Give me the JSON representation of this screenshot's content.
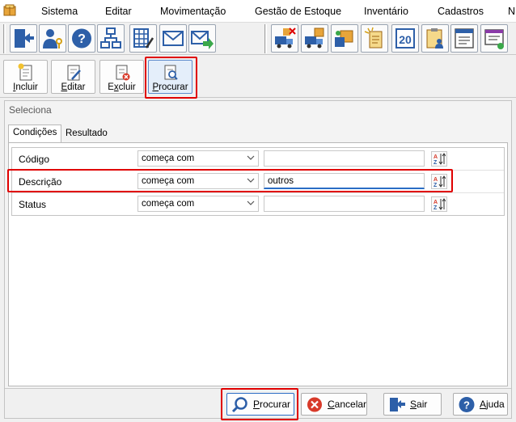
{
  "menu": {
    "items": [
      "Sistema",
      "Editar",
      "Movimentação",
      "Gestão de Estoque",
      "Inventário",
      "Cadastros",
      "N"
    ]
  },
  "toolbar": {
    "left_icons": [
      "exit-door-icon",
      "user-key-icon",
      "help-icon",
      "org-chart-icon",
      "table-edit-icon",
      "envelope-icon",
      "envelope-forward-icon"
    ],
    "right_icons": [
      "truck-box-remove-icon",
      "truck-box-icon",
      "box-transfer-icon",
      "light-note-icon",
      "calendar-20-icon",
      "clipboard-user-icon",
      "document-form-icon",
      "monitor-document-icon"
    ]
  },
  "actions": {
    "incluir": {
      "first": "I",
      "rest": "ncluir"
    },
    "editar": {
      "first": "E",
      "rest": "ditar"
    },
    "excluir": {
      "pre": "E",
      "u": "x",
      "rest": "cluir"
    },
    "procurar": {
      "first": "P",
      "rest": "rocurar"
    }
  },
  "panel": {
    "title": "Seleciona",
    "tabs": [
      "Condições",
      "Resultado"
    ],
    "rows": [
      {
        "label": "Código",
        "condition": "começa com",
        "value": ""
      },
      {
        "label": "Descrição",
        "condition": "começa com",
        "value": "outros"
      },
      {
        "label": "Status",
        "condition": "começa com",
        "value": ""
      }
    ]
  },
  "footer": {
    "procurar": {
      "first": "P",
      "rest": "rocurar"
    },
    "cancelar": {
      "first": "C",
      "rest": "ancelar"
    },
    "sair": {
      "first": "S",
      "rest": "air"
    },
    "ajuda": {
      "first": "A",
      "rest": "juda"
    }
  },
  "colors": {
    "highlight": "#e00000",
    "accent_blue": "#2a6cc4",
    "cancel_red": "#d83a2a"
  }
}
